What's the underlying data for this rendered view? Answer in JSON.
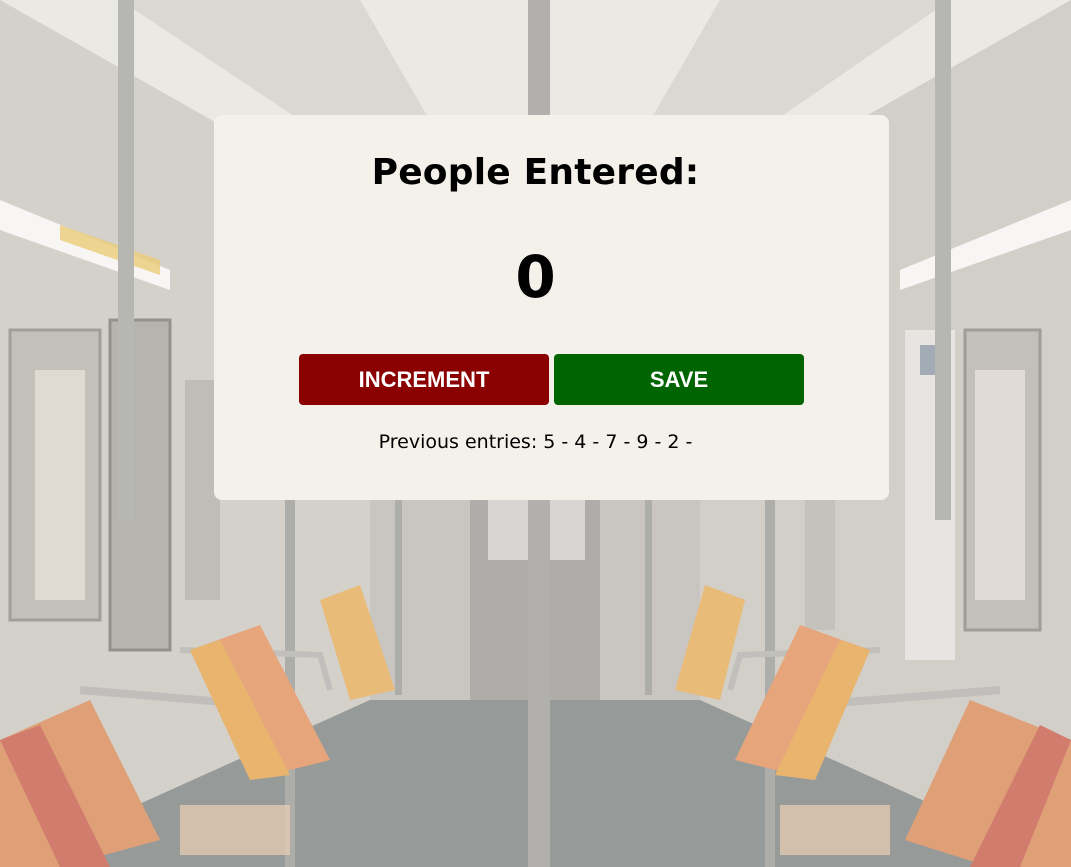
{
  "counter": {
    "title": "People Entered:",
    "count": "0",
    "increment_label": "INCREMENT",
    "save_label": "SAVE",
    "previous_entries": "Previous entries: 5 - 4 - 7 - 9 - 2 -"
  },
  "colors": {
    "card_background": "#f4f1ea",
    "increment_button": "#8b0000",
    "save_button": "#006400"
  }
}
